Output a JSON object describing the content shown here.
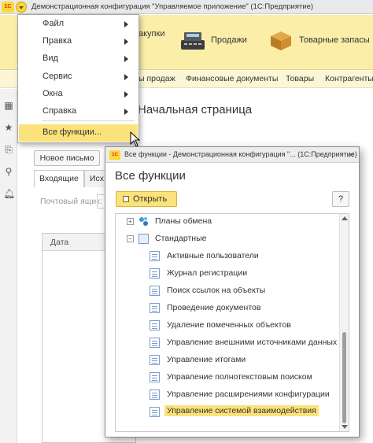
{
  "window": {
    "logo": "1С",
    "title": "Демонстрационная конфигурация \"Управляемое приложение\" (1С:Предприятие)"
  },
  "sections": [
    {
      "label": "Закупки",
      "visible_label": "акупки"
    },
    {
      "label": "Продажи"
    },
    {
      "label": "Товарные запасы"
    }
  ],
  "subsections": [
    {
      "label": "ы продаж"
    },
    {
      "label": "Финансовые документы"
    },
    {
      "label": "Товары"
    },
    {
      "label": "Контрагенты"
    }
  ],
  "main": {
    "page_title": "Начальная страница",
    "new_letter_button": "Новое письмо",
    "tabs": [
      {
        "label": "Входящие"
      },
      {
        "label": "Исх"
      }
    ],
    "mailbox_label": "Почтовый ящик:",
    "grid_column": "Дата"
  },
  "main_menu": {
    "items": [
      {
        "label": "Файл",
        "submenu": true
      },
      {
        "label": "Правка",
        "submenu": true
      },
      {
        "label": "Вид",
        "submenu": true
      },
      {
        "label": "Сервис",
        "submenu": true
      },
      {
        "label": "Окна",
        "submenu": true
      },
      {
        "label": "Справка",
        "submenu": true
      },
      {
        "label": "Все функции...",
        "submenu": false,
        "active": true
      }
    ]
  },
  "dialog": {
    "logo": "1С",
    "title": "Все функции - Демонстрационная конфигурация \"...   (1С:Предприятие)",
    "close_glyph": "×",
    "heading": "Все функции",
    "open_button": "Открыть",
    "help_button": "?",
    "tree": [
      {
        "label": "Планы обмена",
        "level": 0,
        "expander": "+",
        "icon": "exchange-plans-icon"
      },
      {
        "label": "Стандартные",
        "level": 0,
        "expander": "−",
        "icon": "folder-icon"
      },
      {
        "label": "Активные пользователи",
        "level": 1,
        "icon": "document-icon"
      },
      {
        "label": "Журнал регистрации",
        "level": 1,
        "icon": "document-icon"
      },
      {
        "label": "Поиск ссылок на объекты",
        "level": 1,
        "icon": "document-icon"
      },
      {
        "label": "Проведение документов",
        "level": 1,
        "icon": "document-icon"
      },
      {
        "label": "Удаление помеченных объектов",
        "level": 1,
        "icon": "document-icon"
      },
      {
        "label": "Управление внешними источниками данных",
        "level": 1,
        "icon": "document-icon"
      },
      {
        "label": "Управление итогами",
        "level": 1,
        "icon": "document-icon"
      },
      {
        "label": "Управление полнотекстовым поиском",
        "level": 1,
        "icon": "document-icon"
      },
      {
        "label": "Управление расширениями конфигурации",
        "level": 1,
        "icon": "document-icon"
      },
      {
        "label": "Управление системой взаимодействия",
        "level": 1,
        "icon": "document-icon",
        "selected": true
      }
    ]
  },
  "colors": {
    "sections_bg": "#fbeea9",
    "highlight": "#fbe27a",
    "accent_red": "#d32f2f"
  }
}
